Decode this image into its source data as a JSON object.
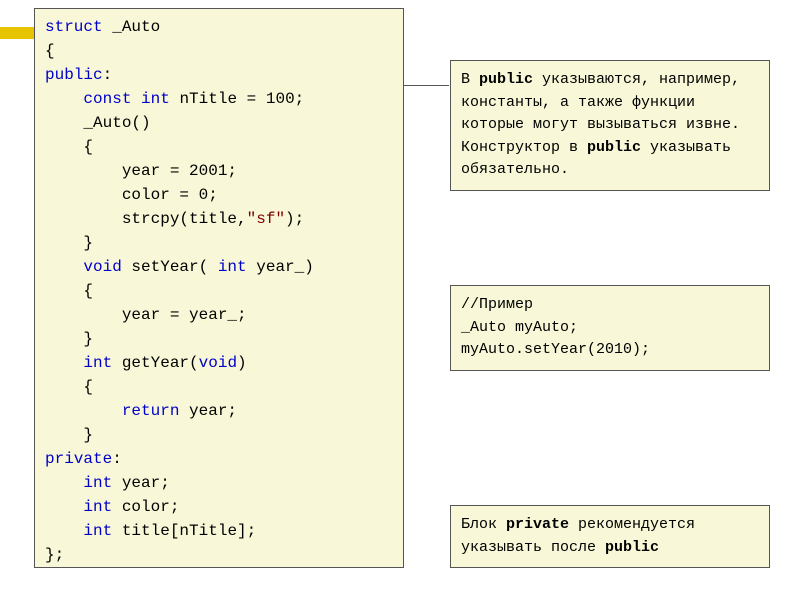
{
  "code": {
    "lines": [
      {
        "indent": 0,
        "tokens": [
          {
            "t": "kw",
            "v": "struct"
          },
          {
            "t": "txt",
            "v": " _Auto"
          }
        ]
      },
      {
        "indent": 0,
        "tokens": [
          {
            "t": "txt",
            "v": "{"
          }
        ]
      },
      {
        "indent": 0,
        "tokens": [
          {
            "t": "kw",
            "v": "public"
          },
          {
            "t": "txt",
            "v": ":"
          }
        ]
      },
      {
        "indent": 1,
        "tokens": [
          {
            "t": "kw",
            "v": "const"
          },
          {
            "t": "txt",
            "v": " "
          },
          {
            "t": "kw",
            "v": "int"
          },
          {
            "t": "txt",
            "v": " nTitle = 100;"
          }
        ]
      },
      {
        "indent": 1,
        "tokens": [
          {
            "t": "txt",
            "v": "_Auto()"
          }
        ]
      },
      {
        "indent": 1,
        "tokens": [
          {
            "t": "txt",
            "v": "{"
          }
        ]
      },
      {
        "indent": 2,
        "tokens": [
          {
            "t": "txt",
            "v": "year = 2001;"
          }
        ]
      },
      {
        "indent": 2,
        "tokens": [
          {
            "t": "txt",
            "v": "color = 0;"
          }
        ]
      },
      {
        "indent": 2,
        "tokens": [
          {
            "t": "txt",
            "v": "strcpy(title,"
          },
          {
            "t": "str",
            "v": "\"sf\""
          },
          {
            "t": "txt",
            "v": ");"
          }
        ]
      },
      {
        "indent": 1,
        "tokens": [
          {
            "t": "txt",
            "v": "}"
          }
        ]
      },
      {
        "indent": 1,
        "tokens": [
          {
            "t": "kw",
            "v": "void"
          },
          {
            "t": "txt",
            "v": " setYear( "
          },
          {
            "t": "kw",
            "v": "int"
          },
          {
            "t": "txt",
            "v": " year_)"
          }
        ]
      },
      {
        "indent": 1,
        "tokens": [
          {
            "t": "txt",
            "v": "{"
          }
        ]
      },
      {
        "indent": 2,
        "tokens": [
          {
            "t": "txt",
            "v": "year = year_;"
          }
        ]
      },
      {
        "indent": 1,
        "tokens": [
          {
            "t": "txt",
            "v": "}"
          }
        ]
      },
      {
        "indent": 1,
        "tokens": [
          {
            "t": "kw",
            "v": "int"
          },
          {
            "t": "txt",
            "v": " getYear("
          },
          {
            "t": "kw",
            "v": "void"
          },
          {
            "t": "txt",
            "v": ")"
          }
        ]
      },
      {
        "indent": 1,
        "tokens": [
          {
            "t": "txt",
            "v": "{"
          }
        ]
      },
      {
        "indent": 2,
        "tokens": [
          {
            "t": "kw",
            "v": "return"
          },
          {
            "t": "txt",
            "v": " year;"
          }
        ]
      },
      {
        "indent": 1,
        "tokens": [
          {
            "t": "txt",
            "v": "}"
          }
        ]
      },
      {
        "indent": 0,
        "tokens": [
          {
            "t": "kw",
            "v": "private"
          },
          {
            "t": "txt",
            "v": ":"
          }
        ]
      },
      {
        "indent": 1,
        "tokens": [
          {
            "t": "kw",
            "v": "int"
          },
          {
            "t": "txt",
            "v": " year;"
          }
        ]
      },
      {
        "indent": 1,
        "tokens": [
          {
            "t": "kw",
            "v": "int"
          },
          {
            "t": "txt",
            "v": " color;"
          }
        ]
      },
      {
        "indent": 1,
        "tokens": [
          {
            "t": "kw",
            "v": "int"
          },
          {
            "t": "txt",
            "v": " title[nTitle];"
          }
        ]
      },
      {
        "indent": 0,
        "tokens": [
          {
            "t": "txt",
            "v": "};"
          }
        ]
      }
    ]
  },
  "notes": {
    "note1": {
      "parts": [
        {
          "t": "txt",
          "v": "В "
        },
        {
          "t": "b",
          "v": "public"
        },
        {
          "t": "txt",
          "v": " указываются, например, константы, а также функции которые могут вызываться извне. Конструктор в "
        },
        {
          "t": "b",
          "v": "public"
        },
        {
          "t": "txt",
          "v": " указывать обязательно."
        }
      ]
    },
    "note2": {
      "line1": "//Пример",
      "line2": "_Auto  myAuto;",
      "line3": "myAuto.setYear(2010);"
    },
    "note3": {
      "parts": [
        {
          "t": "txt",
          "v": "Блок "
        },
        {
          "t": "b",
          "v": "private"
        },
        {
          "t": "txt",
          "v": " рекомендуется указывать после "
        },
        {
          "t": "b",
          "v": "public"
        }
      ]
    }
  }
}
